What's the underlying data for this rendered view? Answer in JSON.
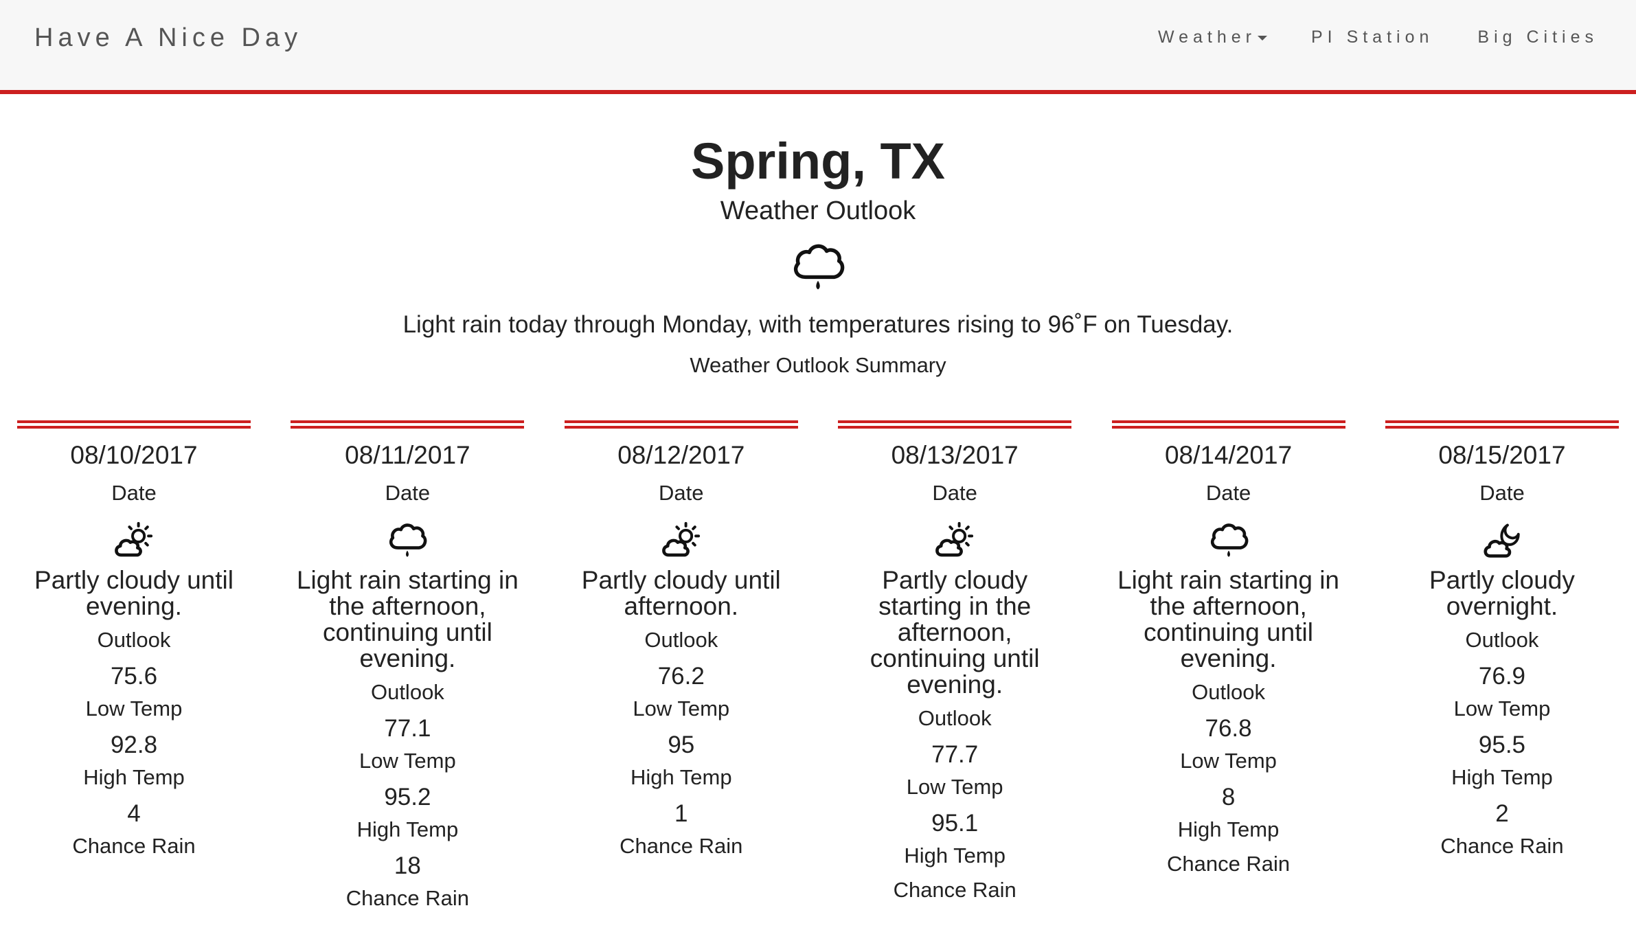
{
  "nav": {
    "brand": "Have A Nice Day",
    "links": [
      {
        "label": "Weather",
        "dropdown": true
      },
      {
        "label": "PI Station",
        "dropdown": false
      },
      {
        "label": "Big Cities",
        "dropdown": false
      }
    ]
  },
  "header": {
    "city": "Spring, TX",
    "subtitle": "Weather Outlook",
    "icon": "rain-cloud-icon",
    "summary": "Light rain today through Monday, with temperatures rising to 96˚F on Tuesday.",
    "summary_label": "Weather Outlook Summary"
  },
  "labels": {
    "date": "Date",
    "outlook": "Outlook",
    "low": "Low Temp",
    "high": "High Temp",
    "rain": "Chance Rain"
  },
  "days": [
    {
      "date": "08/10/2017",
      "icon": "partly-cloudy-day-icon",
      "outlook": "Partly cloudy until evening.",
      "low": "75.6",
      "high": "92.8",
      "rain": "4"
    },
    {
      "date": "08/11/2017",
      "icon": "rain-cloud-icon",
      "outlook": "Light rain starting in the afternoon, continuing until evening.",
      "low": "77.1",
      "high": "95.2",
      "rain": "18"
    },
    {
      "date": "08/12/2017",
      "icon": "partly-cloudy-day-icon",
      "outlook": "Partly cloudy until afternoon.",
      "low": "76.2",
      "high": "95",
      "rain": "1"
    },
    {
      "date": "08/13/2017",
      "icon": "partly-cloudy-day-icon",
      "outlook": "Partly cloudy starting in the afternoon, continuing until evening.",
      "low": "77.7",
      "high": "95.1",
      "rain": ""
    },
    {
      "date": "08/14/2017",
      "icon": "rain-cloud-icon",
      "outlook": "Light rain starting in the afternoon, continuing until evening.",
      "low": "76.8",
      "high": "8",
      "rain": ""
    },
    {
      "date": "08/15/2017",
      "icon": "partly-cloudy-night-icon",
      "outlook": "Partly cloudy overnight.",
      "low": "76.9",
      "high": "95.5",
      "rain": "2"
    }
  ],
  "colors": {
    "accent": "#cc1f1f",
    "navbar_bg": "#f7f7f7",
    "text": "#222222",
    "nav_text": "#555555"
  }
}
